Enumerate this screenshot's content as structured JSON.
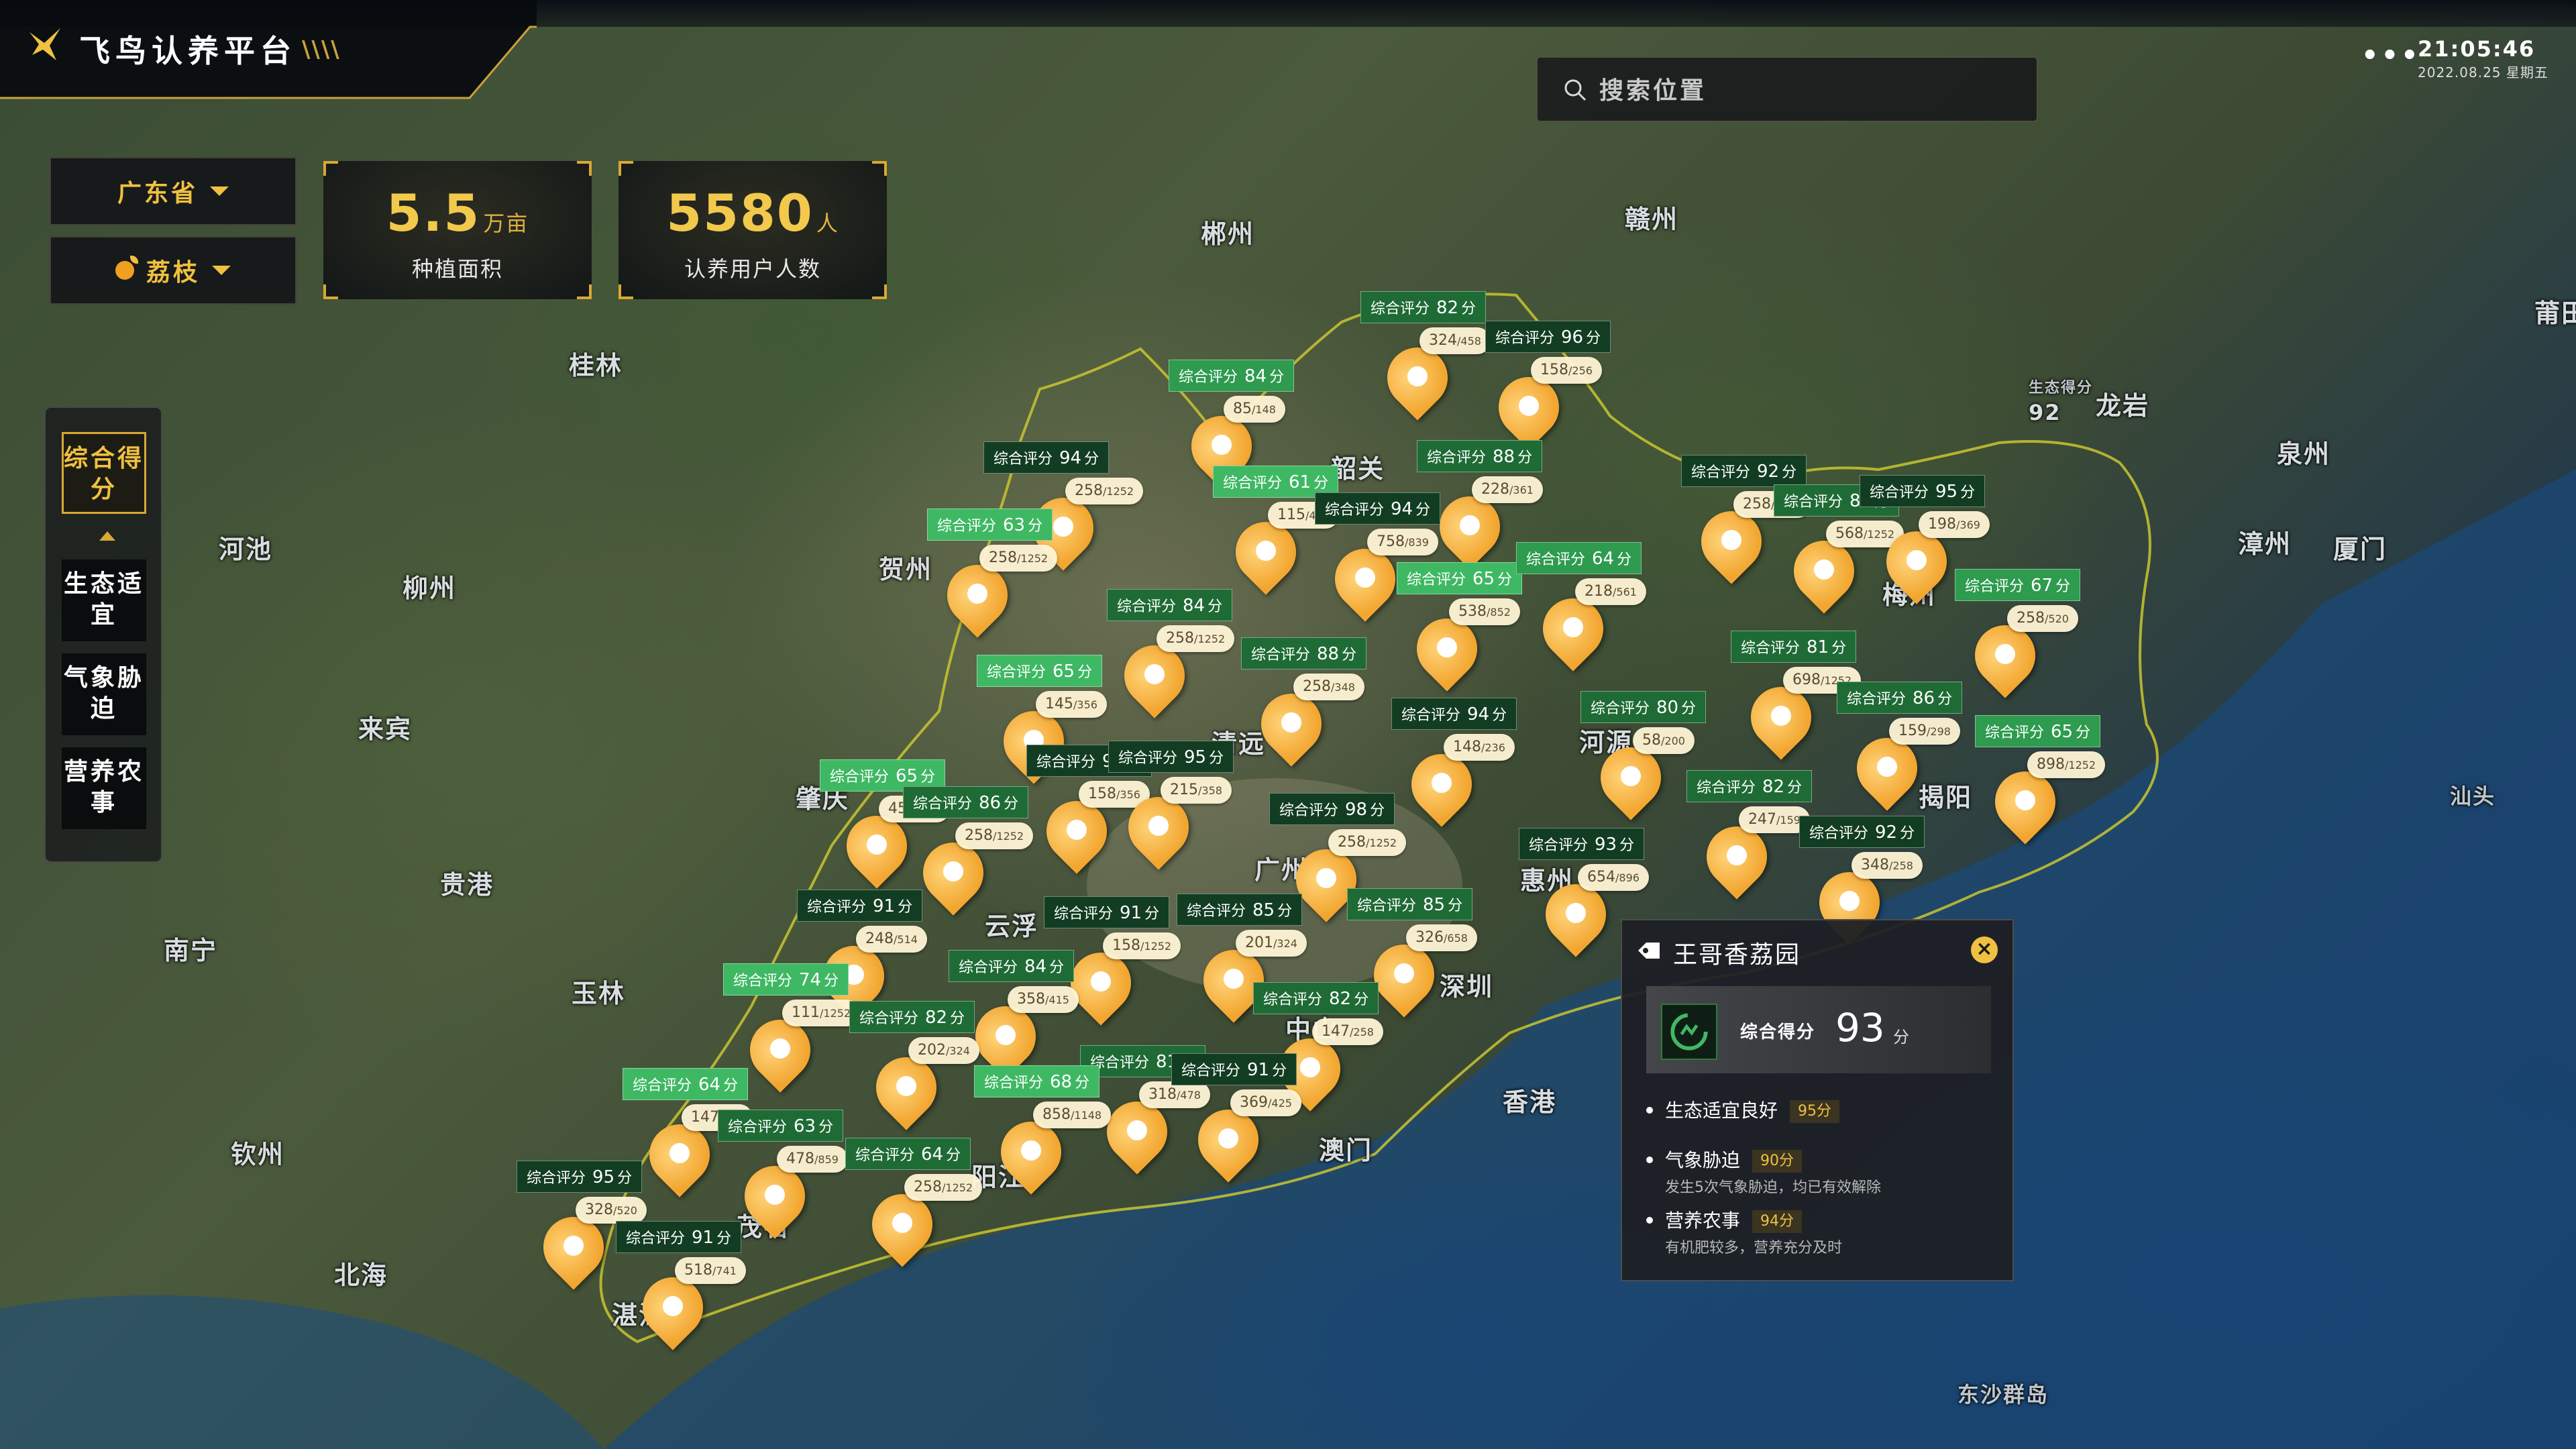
{
  "header": {
    "title": "飞鸟认养平台",
    "stripes": "\\\\\\\\",
    "time": "21:05:46",
    "date": "2022.08.25 星期五",
    "menu": "•••"
  },
  "search": {
    "placeholder": "搜索位置"
  },
  "filters": {
    "province": "广东省",
    "crop": "荔枝"
  },
  "stats": [
    {
      "value": "5.5",
      "unit": "万亩",
      "label": "种植面积"
    },
    {
      "value": "5580",
      "unit": "人",
      "label": "认养用户人数"
    }
  ],
  "layers": [
    {
      "label": "综合得分",
      "active": true
    },
    {
      "label": "生态适宜",
      "active": false
    },
    {
      "label": "气象胁迫",
      "active": false
    },
    {
      "label": "营养农事",
      "active": false
    }
  ],
  "places": [
    {
      "name": "郴州"
    },
    {
      "name": "赣州"
    },
    {
      "name": "柳州"
    },
    {
      "name": "桂林"
    },
    {
      "name": "河池"
    },
    {
      "name": "贺州"
    },
    {
      "name": "韶关"
    },
    {
      "name": "龙岩"
    },
    {
      "name": "泉州"
    },
    {
      "name": "漳州"
    },
    {
      "name": "厦门"
    },
    {
      "name": "莆田"
    },
    {
      "name": "来宾"
    },
    {
      "name": "贵港"
    },
    {
      "name": "南宁"
    },
    {
      "name": "玉林"
    },
    {
      "name": "钦州"
    },
    {
      "name": "北海"
    },
    {
      "name": "清远"
    },
    {
      "name": "河源"
    },
    {
      "name": "揭阳"
    },
    {
      "name": "梅州"
    },
    {
      "name": "云浮"
    },
    {
      "name": "广州"
    },
    {
      "name": "惠州"
    },
    {
      "name": "深圳"
    },
    {
      "name": "香港"
    },
    {
      "name": "澳门"
    },
    {
      "name": "阳江"
    },
    {
      "name": "茂名"
    },
    {
      "name": "中山"
    },
    {
      "name": "肇庆"
    },
    {
      "name": "湛江"
    },
    {
      "name": "东沙群岛"
    },
    {
      "name": "汕头"
    }
  ],
  "map_labels": {
    "eco_small": "生态得分",
    "eco_value": "92"
  },
  "markers": [
    {
      "count": "324",
      "total": "/458",
      "score": "82"
    },
    {
      "count": "158",
      "total": "/256",
      "score": "96"
    },
    {
      "count": "85",
      "total": "/148",
      "score": "84"
    },
    {
      "count": "115",
      "total": "/458",
      "score": "61"
    },
    {
      "count": "228",
      "total": "/361",
      "score": "88"
    },
    {
      "count": "758",
      "total": "/839",
      "score": "94"
    },
    {
      "count": "258",
      "total": "/1252",
      "score": "94"
    },
    {
      "count": "258",
      "total": "/1252",
      "score": "63"
    },
    {
      "count": "258",
      "total": "/1252",
      "score": "84"
    },
    {
      "count": "538",
      "total": "/852",
      "score": "65"
    },
    {
      "count": "218",
      "total": "/561",
      "score": "64"
    },
    {
      "count": "258",
      "total": "/1252",
      "score": "92"
    },
    {
      "count": "568",
      "total": "/1252",
      "score": "86"
    },
    {
      "count": "198",
      "total": "/369",
      "score": "95"
    },
    {
      "count": "258",
      "total": "/520",
      "score": "67"
    },
    {
      "count": "258",
      "total": "/348",
      "score": "88"
    },
    {
      "count": "145",
      "total": "/356",
      "score": "65"
    },
    {
      "count": "148",
      "total": "/236",
      "score": "94"
    },
    {
      "count": "698",
      "total": "/1252",
      "score": "81"
    },
    {
      "count": "159",
      "total": "/298",
      "score": "86"
    },
    {
      "count": "898",
      "total": "/1252",
      "score": "65"
    },
    {
      "count": "58",
      "total": "/200",
      "score": "80"
    },
    {
      "count": "458",
      "total": "/641",
      "score": "65"
    },
    {
      "count": "258",
      "total": "/1252",
      "score": "86"
    },
    {
      "count": "158",
      "total": "/356",
      "score": "95"
    },
    {
      "count": "215",
      "total": "/358",
      "score": "95"
    },
    {
      "count": "258",
      "total": "/1252",
      "score": "98"
    },
    {
      "count": "247",
      "total": "/159",
      "score": "82"
    },
    {
      "count": "348",
      "total": "/258",
      "score": "92"
    },
    {
      "count": "654",
      "total": "/896",
      "score": "93"
    },
    {
      "count": "248",
      "total": "/514",
      "score": "91"
    },
    {
      "count": "158",
      "total": "/1252",
      "score": "91"
    },
    {
      "count": "201",
      "total": "/324",
      "score": "85"
    },
    {
      "count": "326",
      "total": "/658",
      "score": "85"
    },
    {
      "count": "111",
      "total": "/1252",
      "score": "74"
    },
    {
      "count": "358",
      "total": "/415",
      "score": "84"
    },
    {
      "count": "202",
      "total": "/324",
      "score": "82"
    },
    {
      "count": "147",
      "total": "/258",
      "score": "82"
    },
    {
      "count": "318",
      "total": "/478",
      "score": "81"
    },
    {
      "count": "858",
      "total": "/1148",
      "score": "68"
    },
    {
      "count": "369",
      "total": "/425",
      "score": "91"
    },
    {
      "count": "147",
      "total": "/859",
      "score": "64"
    },
    {
      "count": "478",
      "total": "/859",
      "score": "63"
    },
    {
      "count": "258",
      "total": "/1252",
      "score": "64"
    },
    {
      "count": "328",
      "total": "/520",
      "score": "95"
    },
    {
      "count": "518",
      "total": "/741",
      "score": "91"
    }
  ],
  "score_prefix": "综合评分",
  "score_suffix": "分",
  "detail": {
    "name": "王哥香荔园",
    "close": "×",
    "score_label": "综合得分",
    "score": "93",
    "score_unit": "分",
    "items": [
      {
        "title": "生态适宜良好",
        "tag": "95分",
        "note": ""
      },
      {
        "title": "气象胁迫",
        "tag": "90分",
        "note": "发生5次气象胁迫，均已有效解除"
      },
      {
        "title": "营养农事",
        "tag": "94分",
        "note": "有机肥较多，营养充分及时"
      }
    ]
  },
  "colors": {
    "accent": "#f0c040",
    "pin": "#f2a630",
    "score_green": "#2e9b4f"
  }
}
